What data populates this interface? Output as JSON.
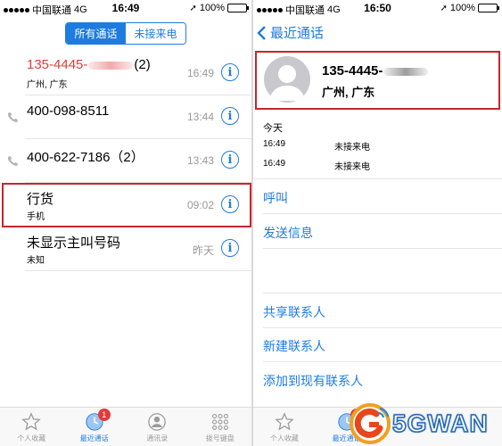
{
  "left": {
    "status": {
      "carrier": "中国联通",
      "network": "4G",
      "time": "16:49",
      "battery": "100%",
      "battery_level": 1.0
    },
    "segments": {
      "all": "所有通话",
      "missed": "未接来电"
    },
    "calls": [
      {
        "name_prefix": "135-4445-",
        "name_suffix": "(2)",
        "sub": "广州, 广东",
        "time": "16:49",
        "missed": true
      },
      {
        "name_prefix": "400-098-8511",
        "name_suffix": "",
        "sub": "",
        "time": "13:44",
        "missed": false
      },
      {
        "name_prefix": "400-622-7186（2）",
        "name_suffix": "",
        "sub": "",
        "time": "13:43",
        "missed": false
      },
      {
        "name_prefix": "行货",
        "name_suffix": "",
        "sub": "手机",
        "time": "09:02",
        "missed": false
      },
      {
        "name_prefix": "未显示主叫号码",
        "name_suffix": "",
        "sub": "未知",
        "time": "昨天",
        "missed": false
      }
    ],
    "tabs": [
      {
        "label": "个人收藏",
        "icon": "star-icon"
      },
      {
        "label": "最近通话",
        "icon": "clock-icon",
        "badge": "1"
      },
      {
        "label": "通讯录",
        "icon": "contacts-icon"
      },
      {
        "label": "拨号键盘",
        "icon": "keypad-icon"
      }
    ]
  },
  "right": {
    "status": {
      "carrier": "中国联通",
      "network": "4G",
      "time": "16:50",
      "battery": "100%",
      "battery_level": 1.0
    },
    "back_label": "最近通话",
    "contact": {
      "number_prefix": "135-4445-",
      "location": "广州, 广东"
    },
    "history_title": "今天",
    "history": [
      {
        "time": "16:49",
        "type": "未接来电"
      },
      {
        "time": "16:49",
        "type": "未接来电"
      }
    ],
    "actions_primary": [
      "呼叫",
      "发送信息"
    ],
    "actions_secondary": [
      "共享联系人",
      "新建联系人",
      "添加到现有联系人"
    ],
    "tabs": [
      {
        "label": "个人收藏",
        "icon": "star-icon"
      },
      {
        "label": "最近通话",
        "icon": "clock-icon",
        "badge": "1"
      }
    ]
  },
  "watermark": "5GWAN",
  "colors": {
    "accent": "#1e7ce0",
    "missed": "#e23b3b",
    "highlight": "#c6262e"
  }
}
